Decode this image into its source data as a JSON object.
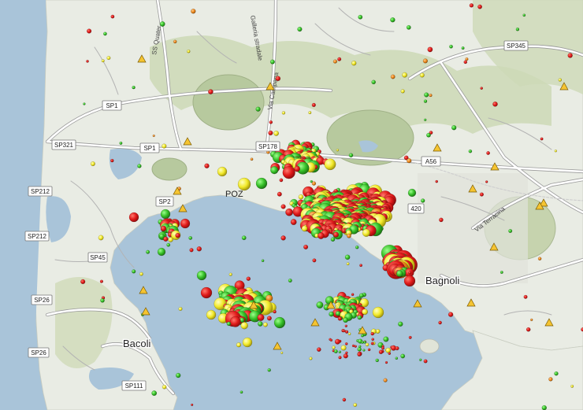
{
  "map": {
    "colors": {
      "sea": "#a9c4d9",
      "land": "#e9ece4",
      "green_area": "#cdd9b6",
      "crater": "#b7c99e",
      "road": "#ffffff",
      "road_outline": "#9a9a9a",
      "quake_red": "#e01919",
      "quake_yellow": "#f2ea2a",
      "quake_green": "#36c028",
      "quake_orange": "#ef8a1d",
      "triangle": "#f5c431"
    },
    "road_labels": [
      "SP345",
      "SP1",
      "SP1",
      "SP321",
      "SP178",
      "A56",
      "SP212",
      "SP212",
      "SP2",
      "SP45",
      "SP26",
      "SP26",
      "SP111",
      "420"
    ],
    "place_labels": [
      "Pozzuoli",
      "Bagnoli",
      "Bacoli"
    ],
    "place_labels_visible": [
      "POZ",
      "Bagnoli",
      "Bacoli"
    ],
    "street_labels": [
      "SS Quater",
      "Galleria stradale",
      "Via Campana",
      "Via Terracina"
    ],
    "legend_categories": [
      "red",
      "yellow",
      "green",
      "orange"
    ],
    "marker_shapes": [
      "earthquake-circle",
      "station-triangle"
    ]
  }
}
